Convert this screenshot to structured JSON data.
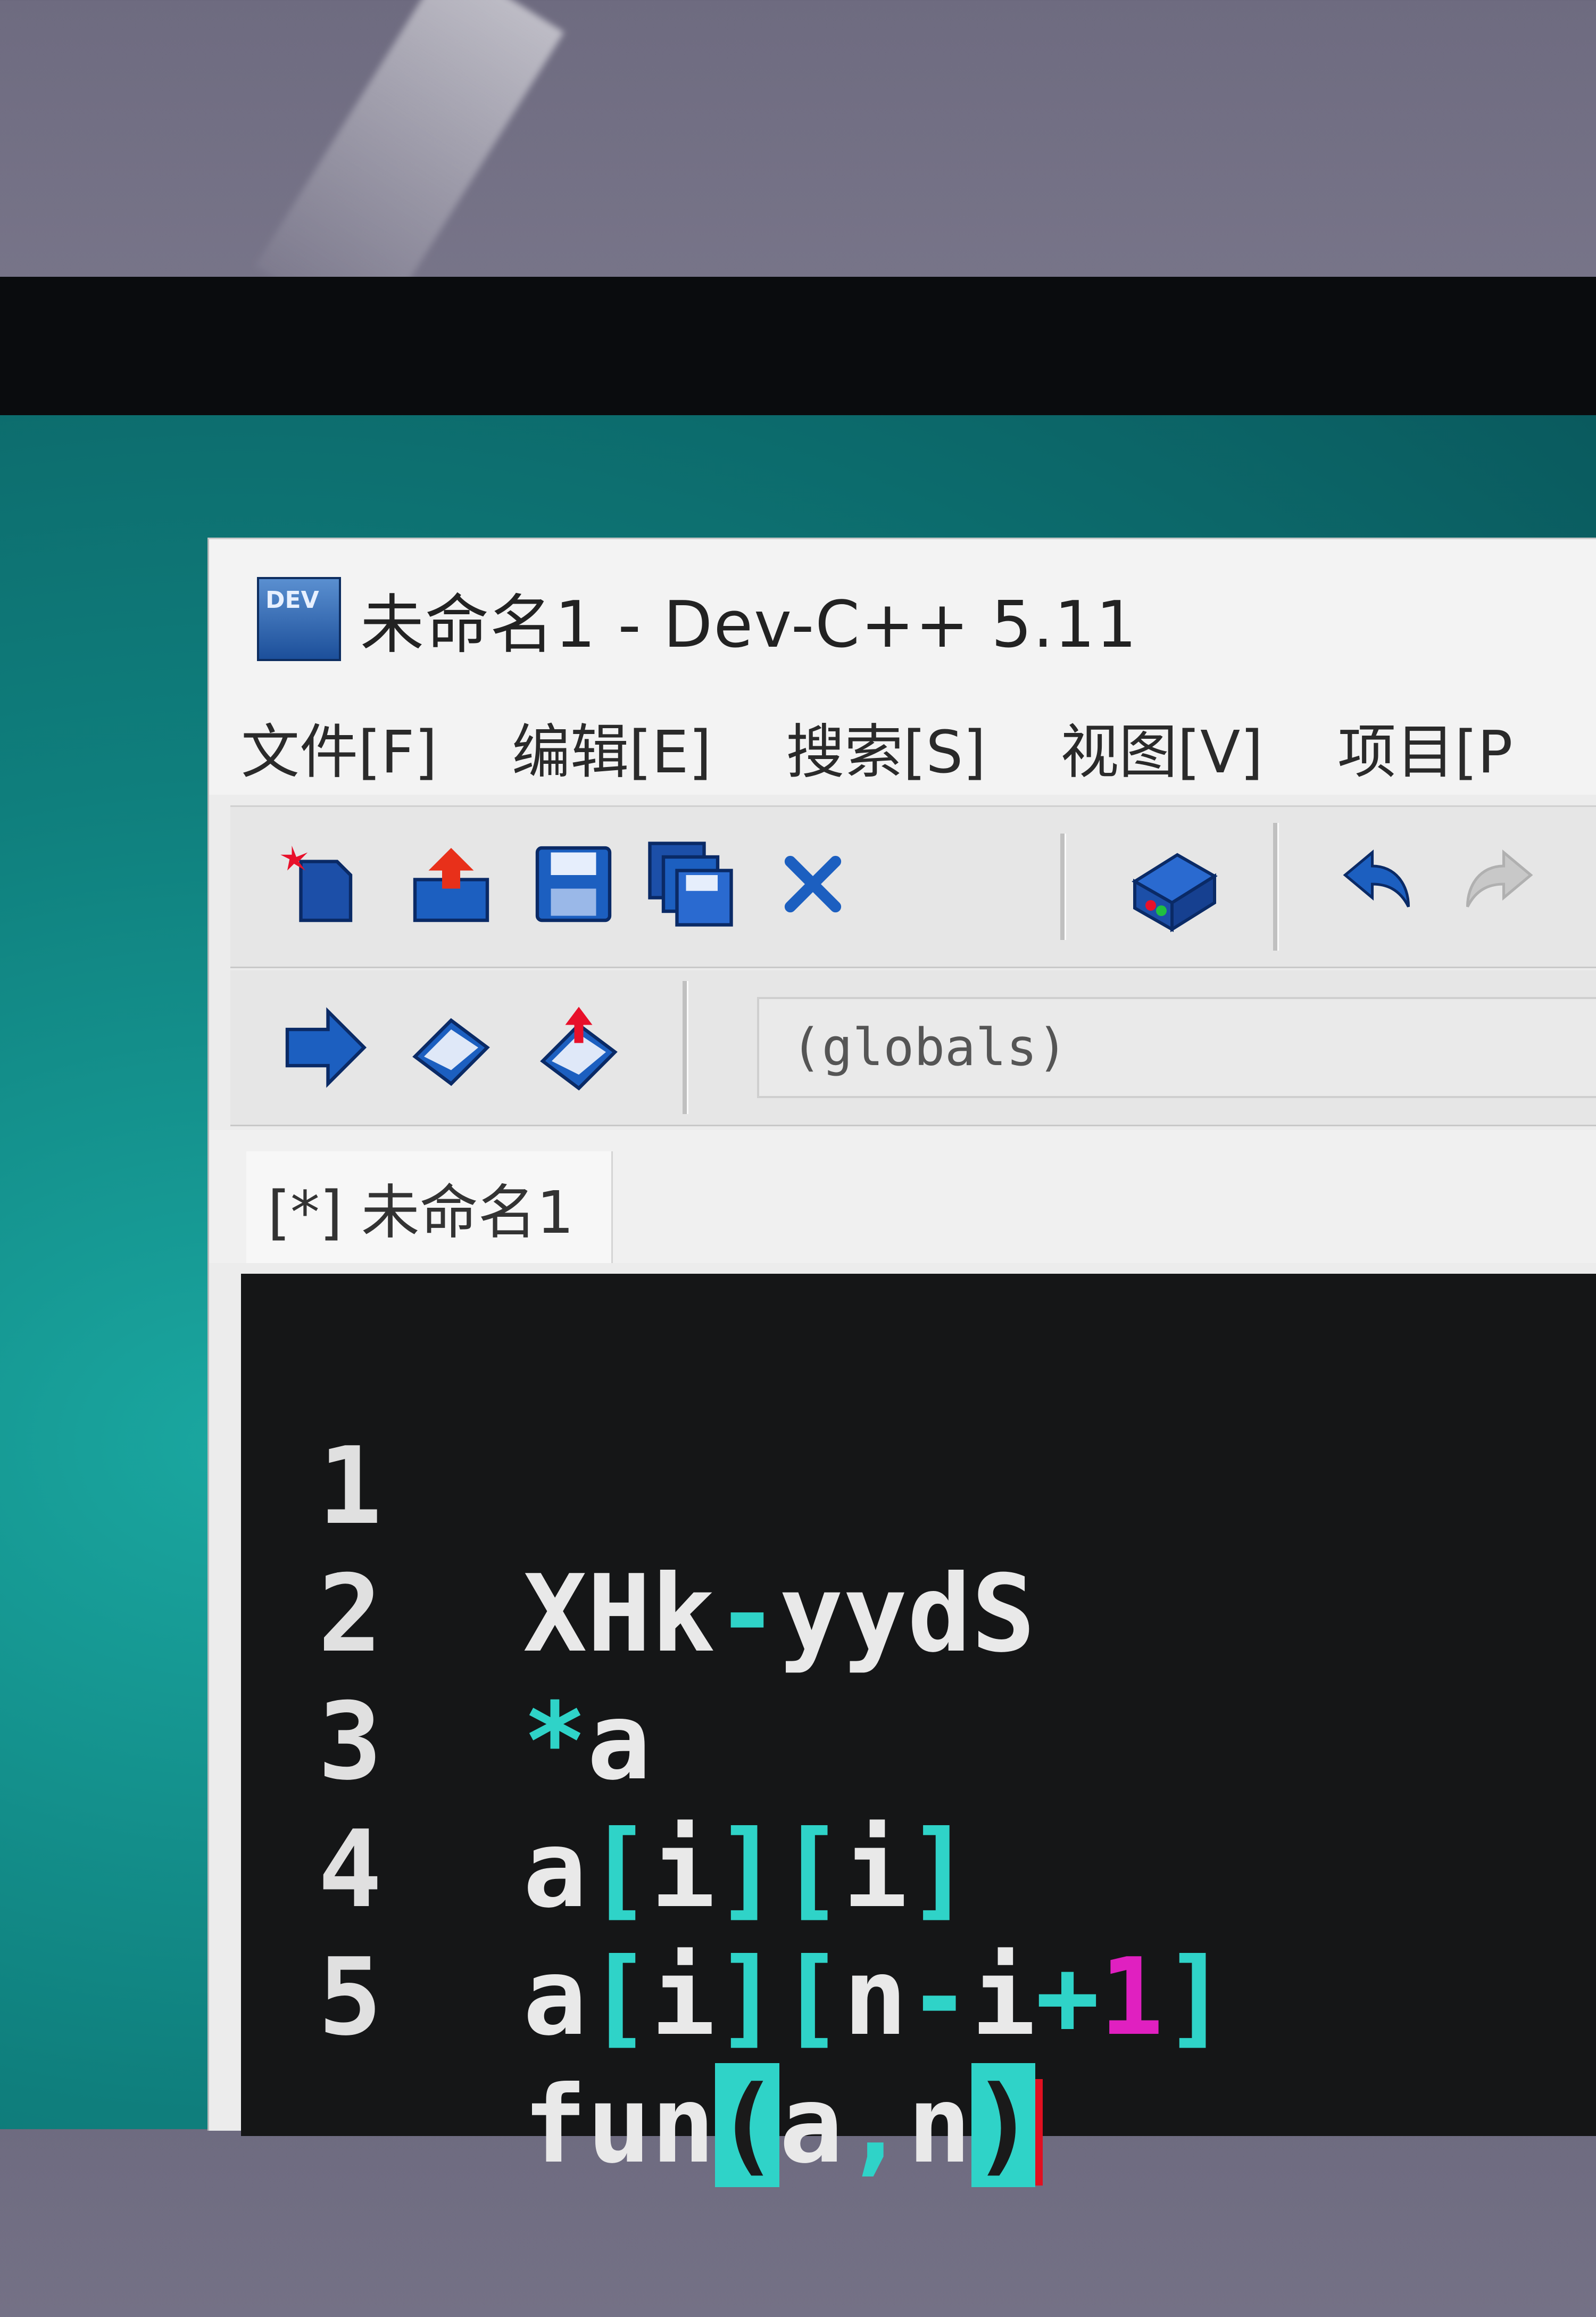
{
  "window": {
    "title": "未命名1 - Dev-C++ 5.11"
  },
  "menu": {
    "items": [
      "文件[F]",
      "编辑[E]",
      "搜索[S]",
      "视图[V]",
      "项目[P"
    ]
  },
  "toolbar": {
    "icons": [
      "new-file-icon",
      "open-file-icon",
      "save-icon",
      "save-all-icon",
      "close-icon",
      "print-icon",
      "undo-icon",
      "redo-icon"
    ],
    "row2_icons": [
      "goto-icon",
      "bookmark-icon",
      "bookmark-add-icon"
    ],
    "scope_value": "(globals)"
  },
  "tabs": [
    {
      "label": "[*] 未命名1"
    }
  ],
  "editor": {
    "lines": [
      {
        "number": "1",
        "text": "XHk-yydS"
      },
      {
        "number": "2",
        "text": "*a"
      },
      {
        "number": "3",
        "text": "a[i][i]"
      },
      {
        "number": "4",
        "text": "a[i][n-i+1]"
      },
      {
        "number": "5",
        "text": "fun(a,n)"
      }
    ],
    "colors": {
      "background": "#151617",
      "bracket": "#2fd3c8",
      "number_literal": "#e020c0",
      "caret": "#e01020"
    }
  }
}
